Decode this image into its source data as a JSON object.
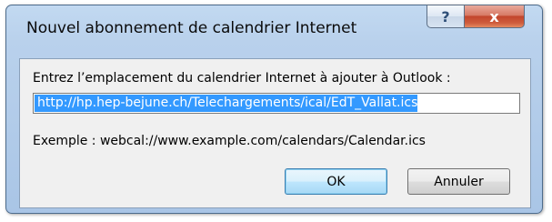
{
  "dialog": {
    "title": "Nouvel abonnement de calendrier Internet",
    "help_label": "?",
    "close_label": "x"
  },
  "form": {
    "prompt": "Entrez l’emplacement du calendrier Internet à ajouter à Outlook :",
    "url_value": "http://hp.hep-bejune.ch/Telechargements/ical/EdT_Vallat.ics",
    "example": "Exemple : webcal://www.example.com/calendars/Calendar.ics"
  },
  "buttons": {
    "ok_label": "OK",
    "cancel_label": "Annuler"
  }
}
